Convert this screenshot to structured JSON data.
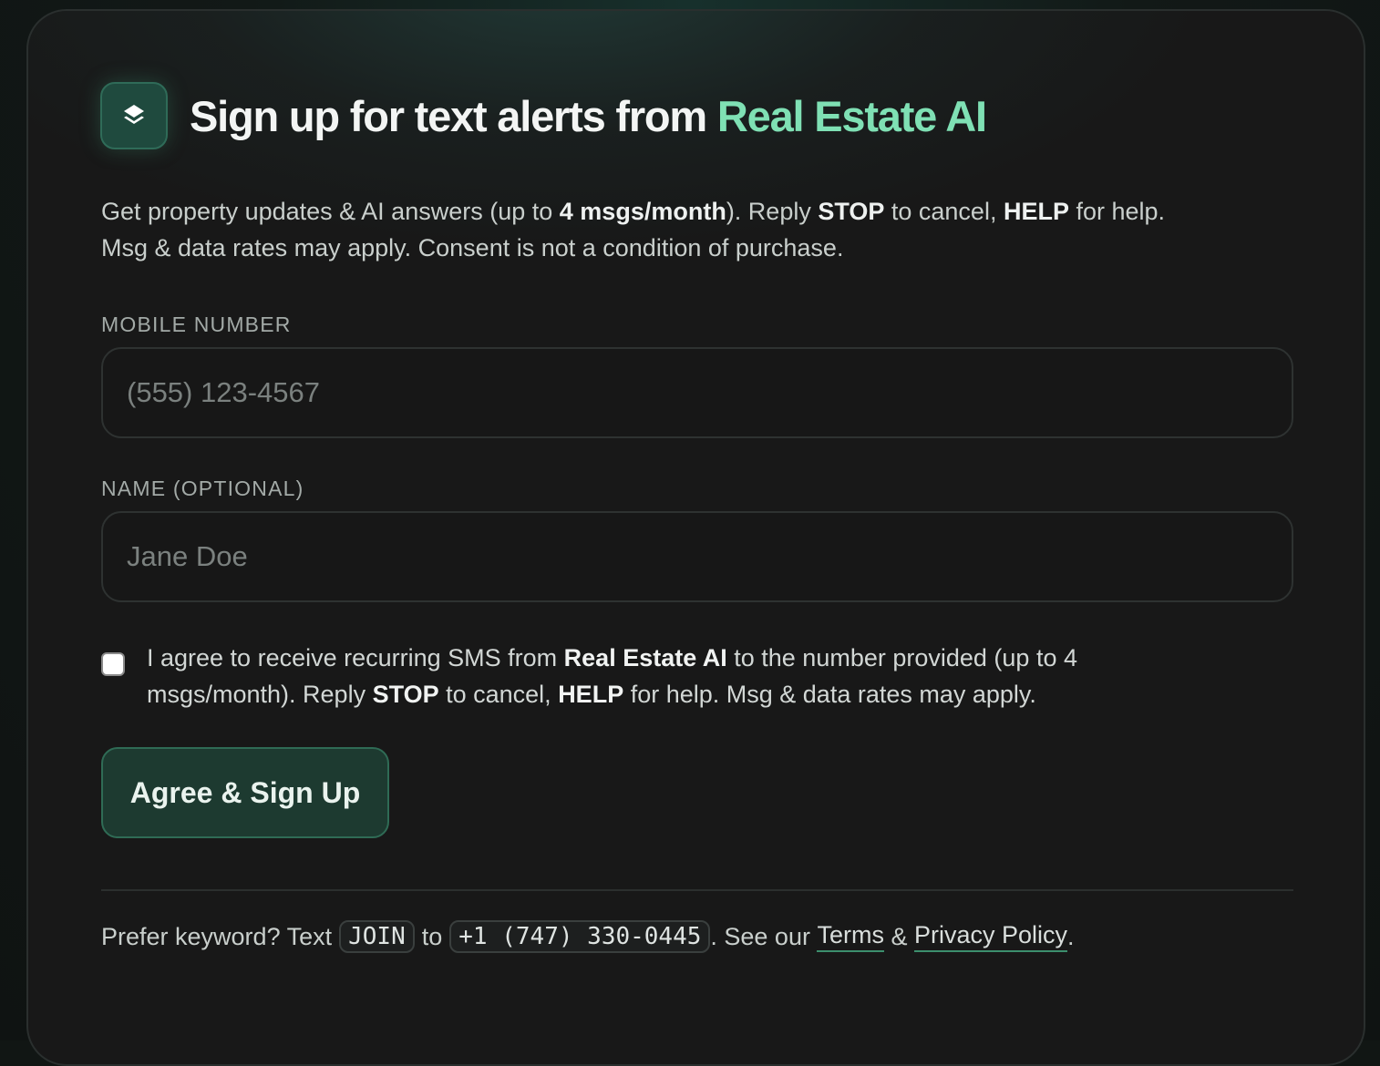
{
  "header": {
    "logo_icon": "layers-icon",
    "title_prefix": "Sign up for text alerts from ",
    "title_brand": "Real Estate AI"
  },
  "description": {
    "line1_a": "Get property updates & AI answers (up to ",
    "line1_b": "4 msgs/month",
    "line1_c": "). Reply ",
    "line1_d": "STOP",
    "line1_e": " to cancel, ",
    "line1_f": "HELP",
    "line1_g": " for help.",
    "line2": "Msg & data rates may apply. Consent is not a condition of purchase."
  },
  "form": {
    "mobile_label": "MOBILE NUMBER",
    "mobile_placeholder": "(555) 123-4567",
    "name_label": "NAME (OPTIONAL)",
    "name_placeholder": "Jane Doe",
    "consent": {
      "a": "I agree to receive recurring SMS from ",
      "b": "Real Estate AI",
      "c": " to the number provided (up to 4 msgs/month). Reply ",
      "d": "STOP",
      "e": " to cancel, ",
      "f": "HELP",
      "g": " for help. Msg & data rates may apply."
    },
    "submit_label": "Agree & Sign Up"
  },
  "footer": {
    "prefix": "Prefer keyword? Text",
    "keyword": "JOIN",
    "to": "to",
    "phone": "+1 (747) 330-0445",
    "see_our": ". See our ",
    "terms_link": "Terms",
    "amp": " & ",
    "privacy_link": "Privacy Policy",
    "period": "."
  },
  "colors": {
    "brand_green": "#7fe0b4",
    "button_bg": "#1d3a30",
    "card_bg": "#181818"
  }
}
